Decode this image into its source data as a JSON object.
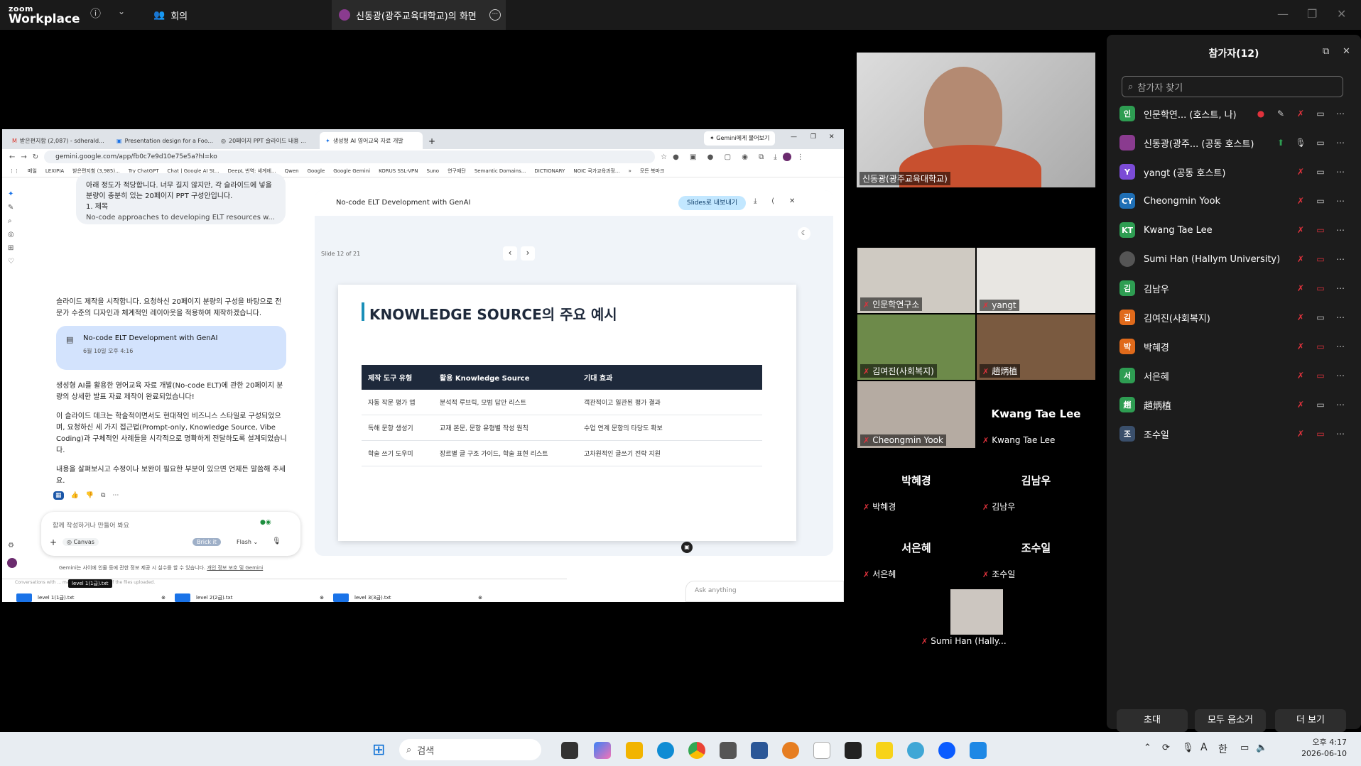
{
  "zoom": {
    "logo_small": "zoom",
    "logo_big": "Workplace",
    "info_icon": "ⓘ",
    "meeting_label": "회의",
    "share_title": "신동광(광주교육대학교)의 화면"
  },
  "browser": {
    "tabs": [
      "받은편지함 (2,087) - sdherald...",
      "Presentation design for a Foo...",
      "20페이지 PPT 슬라이드 내용 ...",
      "생성형 AI 영어교육 자료 개발"
    ],
    "ask_gemini": "Gemini에게 물어보기",
    "url": "gemini.google.com/app/fb0c7e9d10e75e5a?hl=ko",
    "bookmarks": [
      "메일",
      "LEXIPIA",
      "받은편지함 (3,985)...",
      "Try ChatGPT",
      "Chat | Google AI St...",
      "DeepL 번역: 세계에...",
      "Qwen",
      "Google",
      "Google Gemini",
      "KORUS SSL-VPN",
      "Suno",
      "연구재단",
      "Semantic Domains...",
      "DICTIONARY",
      "NOIC 국가교육과정..."
    ],
    "all_bookmarks": "모든 북마크"
  },
  "gemini": {
    "user_msg": "아래 정도가 적당합니다. 너무 길지 않지만, 각 슬라이드에 넣을 분량이 충분히 있는 20페이지 PPT 구성안입니다.",
    "user_msg_2": "1. 제목",
    "user_msg_3": "No-code approaches to developing ELT resources w...",
    "reply_1": "슬라이드 제작을 시작합니다. 요청하신 20페이지 분량의 구성을 바탕으로 전문가 수준의 디자인과 체계적인 레이아웃을 적용하여 제작하겠습니다.",
    "card_title": "No-code ELT Development with GenAI",
    "card_date": "6월 10일 오후 4:16",
    "reply_2": "생성형 AI를 활용한 영어교육 자료 개발(No-code ELT)에 관한 20페이지 분량의 상세한 발표 자료 제작이 완료되었습니다!",
    "reply_3": "이 슬라이드 데크는 학술적이면서도 현대적인 비즈니스 스타일로 구성되었으며, 요청하신 세 가지 접근법(Prompt-only, Knowledge Source, Vibe Coding)과 구체적인 사례들을 시각적으로 명확하게 전달하도록 설계되었습니다.",
    "reply_4": "내용을 살펴보시고 수정이나 보완이 필요한 부분이 있으면 언제든 말씀해 주세요.",
    "input_placeholder": "함께 작성하거나 만들어 봐요",
    "canvas_label": "Canvas",
    "brick_label": "Brick it",
    "flash_label": "Flash",
    "disclaimer": "Gemini는 사이에 인물 등에 관한 정보 제공 시 실수를 할 수 있습니다.",
    "privacy_link": "개인 정보 보호 및 Gemini",
    "behind_text": "Conversations with ... may reveal part or all of the files uploaded.",
    "tooltip": "level 1(1급).txt",
    "files": [
      "level 1(1급).txt",
      "level 2(2급).txt",
      "level 3(3급).txt"
    ],
    "ask_anything": "Ask anything"
  },
  "canvas": {
    "title": "No-code ELT Development with GenAI",
    "export_btn": "Slides로 내보내기",
    "slide_counter": "Slide 12 of 21",
    "slide_title": "KNOWLEDGE SOURCE의 주요 예시",
    "table_headers": [
      "제작 도구 유형",
      "활용 Knowledge Source",
      "기대 효과"
    ],
    "table_rows": [
      [
        "자동 작문 평가 앱",
        "분석적 루브릭, 모범 답안 리스트",
        "객관적이고 일관된 평가 결과"
      ],
      [
        "독해 문항 생성기",
        "교재 본문, 문항 유형별 작성 원칙",
        "수업 연계 문항의 타당도 확보"
      ],
      [
        "학술 쓰기 도우미",
        "장르별 글 구조 가이드, 학술 표현 리스트",
        "고차원적인 글쓰기 전략 지원"
      ]
    ]
  },
  "videos": {
    "main_speaker": "신동광(광주교육대학교)",
    "tiles": [
      "인문학연구소",
      "yangt",
      "김여진(사회복지)",
      "趙炳植",
      "Cheongmin Yook",
      "Kwang Tae Lee"
    ],
    "kwang_display": "Kwang Tae Lee",
    "blank": [
      {
        "display": "박혜경",
        "label": "박혜경"
      },
      {
        "display": "김남우",
        "label": "김남우"
      },
      {
        "display": "서은혜",
        "label": "서은혜"
      },
      {
        "display": "조수일",
        "label": "조수일"
      }
    ],
    "sumi_label": "Sumi Han (Hally..."
  },
  "participants": {
    "title": "참가자(12)",
    "search_placeholder": "참가자 찾기",
    "list": [
      {
        "initial": "인",
        "name": "인문학연...  (호스트, 나)",
        "color": "#2e9d52"
      },
      {
        "initial": "",
        "name": "신동광(광주...  (공동 호스트)",
        "color": "#8a3b8f"
      },
      {
        "initial": "Y",
        "name": "yangt (공동 호스트)",
        "color": "#7b4bd6"
      },
      {
        "initial": "CY",
        "name": "Cheongmin Yook",
        "color": "#1f6fb5"
      },
      {
        "initial": "KT",
        "name": "Kwang Tae Lee",
        "color": "#2e9d52"
      },
      {
        "initial": "",
        "name": "Sumi Han (Hallym University)",
        "color": "#555555"
      },
      {
        "initial": "김",
        "name": "김남우",
        "color": "#2e9d52"
      },
      {
        "initial": "김",
        "name": "김여진(사회복지)",
        "color": "#e06a1b"
      },
      {
        "initial": "박",
        "name": "박혜경",
        "color": "#e06a1b"
      },
      {
        "initial": "서",
        "name": "서은혜",
        "color": "#2e9d52"
      },
      {
        "initial": "趙",
        "name": "趙炳植",
        "color": "#2e9d52"
      },
      {
        "initial": "조",
        "name": "조수일",
        "color": "#3a4f6b"
      }
    ],
    "invite": "초대",
    "mute_all": "모두 음소거",
    "more": "더 보기"
  },
  "taskbar": {
    "search": "검색",
    "time": "오후 4:17",
    "date": "2026-06-10",
    "lang": "A",
    "ime": "한"
  }
}
